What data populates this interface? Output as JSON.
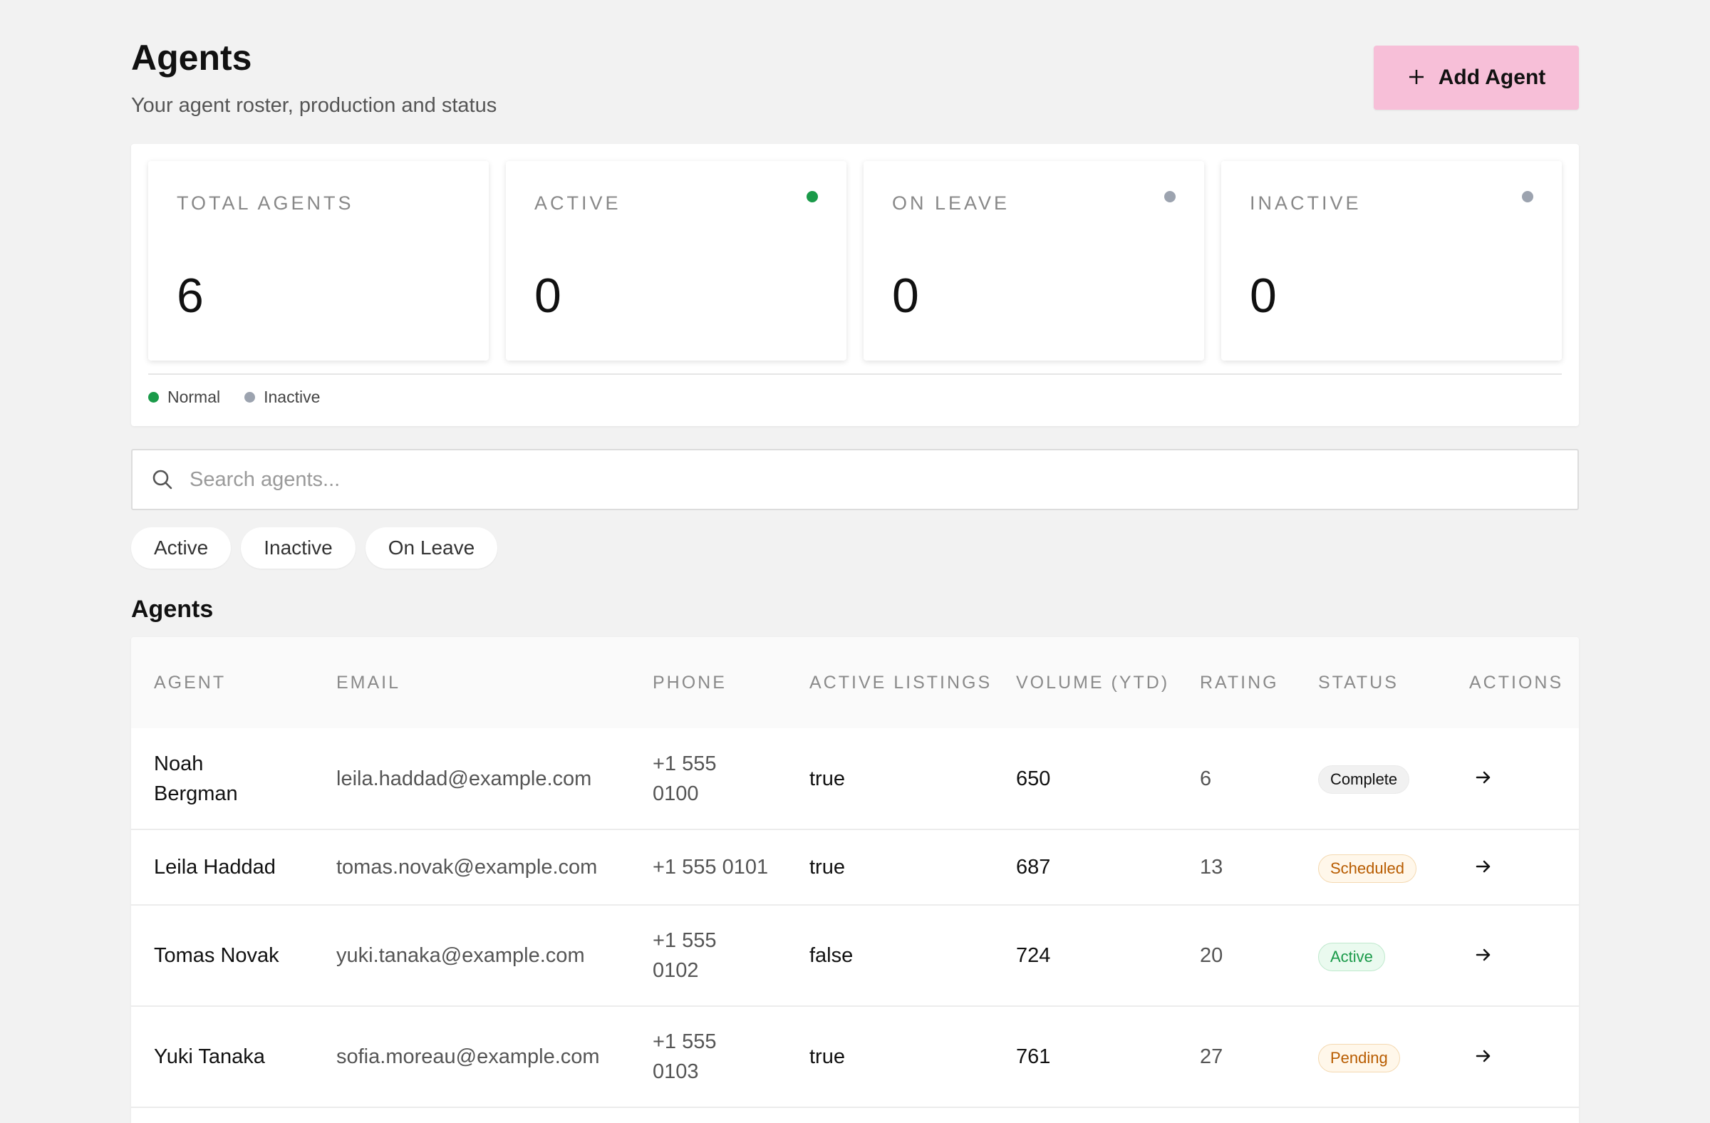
{
  "header": {
    "title": "Agents",
    "subtitle": "Your agent roster, production and status",
    "add_button_label": "Add Agent"
  },
  "stats": [
    {
      "label": "TOTAL AGENTS",
      "value": "6",
      "dot": null
    },
    {
      "label": "ACTIVE",
      "value": "0",
      "dot": "#1a9a49"
    },
    {
      "label": "ON LEAVE",
      "value": "0",
      "dot": "#9ca3af"
    },
    {
      "label": "INACTIVE",
      "value": "0",
      "dot": "#9ca3af"
    }
  ],
  "legend": [
    {
      "label": "Normal",
      "color": "#1a9a49"
    },
    {
      "label": "Inactive",
      "color": "#9ca3af"
    }
  ],
  "search": {
    "placeholder": "Search agents..."
  },
  "filters": [
    "Active",
    "Inactive",
    "On Leave"
  ],
  "section_title": "Agents",
  "table": {
    "columns": [
      "AGENT",
      "EMAIL",
      "PHONE",
      "ACTIVE LISTINGS",
      "VOLUME (YTD)",
      "RATING",
      "STATUS",
      "ACTIONS"
    ],
    "rows": [
      {
        "agent": "Noah Bergman",
        "email": "leila.haddad@example.com",
        "phone": "+1 555 0100",
        "listings": "true",
        "volume": "650",
        "rating": "6",
        "status": "Complete"
      },
      {
        "agent": "Leila Haddad",
        "email": "tomas.novak@example.com",
        "phone": "+1 555 0101",
        "listings": "true",
        "volume": "687",
        "rating": "13",
        "status": "Scheduled"
      },
      {
        "agent": "Tomas Novak",
        "email": "yuki.tanaka@example.com",
        "phone": "+1 555 0102",
        "listings": "false",
        "volume": "724",
        "rating": "20",
        "status": "Active"
      },
      {
        "agent": "Yuki Tanaka",
        "email": "sofia.moreau@example.com",
        "phone": "+1 555 0103",
        "listings": "true",
        "volume": "761",
        "rating": "27",
        "status": "Pending"
      }
    ]
  },
  "icons": {
    "add": "plus-icon",
    "search": "search-icon",
    "row_action": "arrow-right-icon"
  }
}
